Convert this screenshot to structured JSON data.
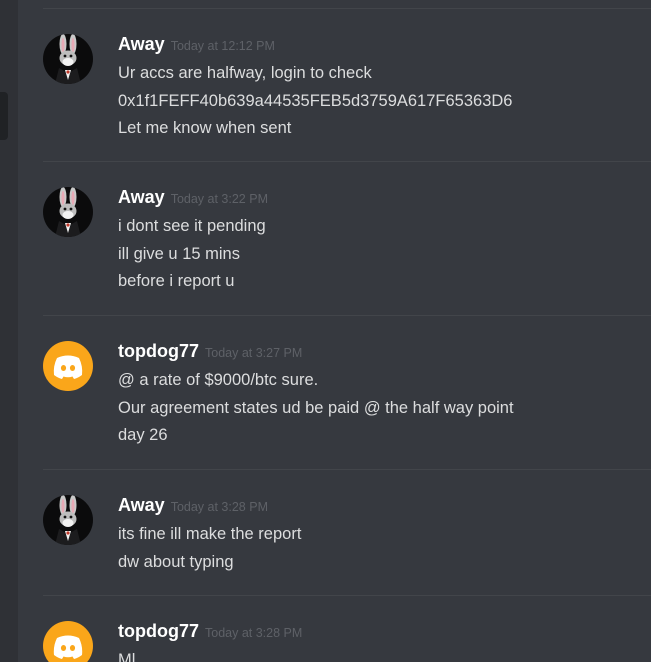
{
  "messages": [
    {
      "author": "Away",
      "avatar": "bunny-avatar",
      "timestamp": "Today at 12:12 PM",
      "lines": [
        "Ur accs are halfway, login to check",
        "0x1f1FEFF40b639a44535FEB5d3759A617F65363D6",
        "Let me know when sent"
      ]
    },
    {
      "author": "Away",
      "avatar": "bunny-avatar",
      "timestamp": "Today at 3:22 PM",
      "lines": [
        "i dont see it pending",
        "ill give u 15 mins",
        "before i report u"
      ]
    },
    {
      "author": "topdog77",
      "avatar": "discord-avatar",
      "timestamp": "Today at 3:27 PM",
      "lines": [
        "@ a rate of $9000/btc sure.",
        "Our agreement states ud be paid @ the half way point",
        "day 26"
      ]
    },
    {
      "author": "Away",
      "avatar": "bunny-avatar",
      "timestamp": "Today at 3:28 PM",
      "lines": [
        "its fine ill make the report",
        "dw about typing"
      ]
    },
    {
      "author": "topdog77",
      "avatar": "discord-avatar",
      "timestamp": "Today at 3:28 PM",
      "lines": [
        "Ml"
      ]
    }
  ],
  "colors": {
    "background": "#36393f",
    "sidebar": "#2f3136",
    "username": "#ffffff",
    "timestamp": "#5e6167",
    "text": "#dcddde",
    "discord_avatar": "#faa61a"
  }
}
